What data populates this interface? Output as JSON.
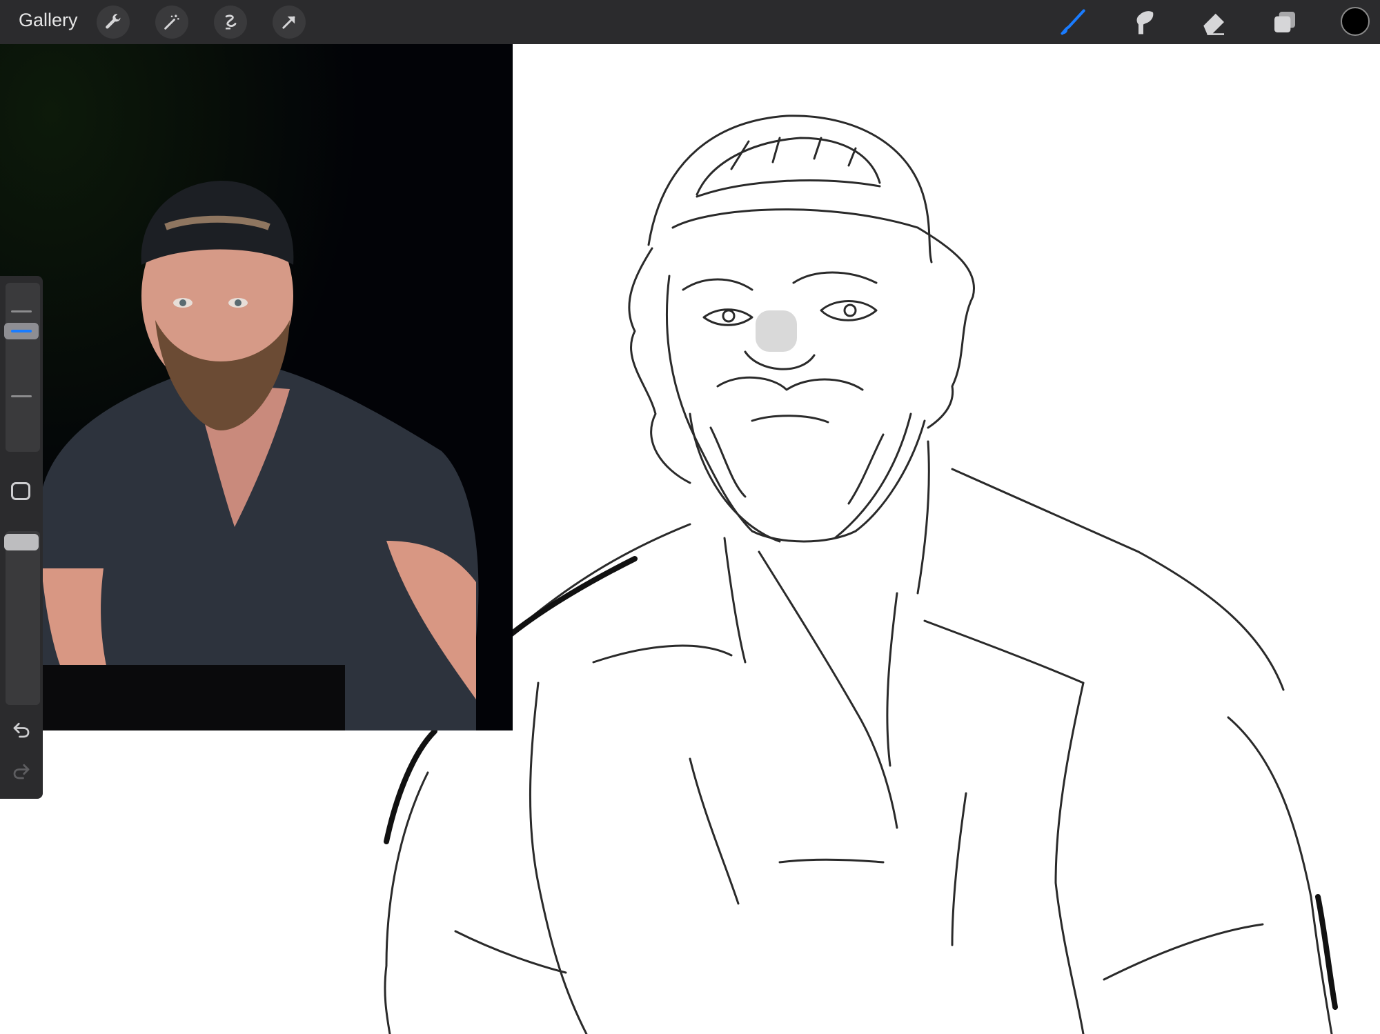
{
  "toolbar": {
    "gallery_label": "Gallery",
    "left_tools": [
      "wrench-icon",
      "magic-wand-icon",
      "selection-icon",
      "transform-arrow-icon"
    ],
    "right_tools": [
      "brush-icon",
      "smudge-icon",
      "eraser-icon",
      "layers-icon"
    ],
    "active_tool": "brush-icon",
    "accent_color": "#1a7cff",
    "current_color": "#000000"
  },
  "sidebar": {
    "brush_size_level": 0.3,
    "opacity_level": 0.0,
    "controls": [
      "brush-size-slider",
      "modify-button",
      "opacity-slider",
      "undo-icon",
      "redo-icon"
    ]
  },
  "reference": {
    "description_icon": "reference-photo"
  }
}
